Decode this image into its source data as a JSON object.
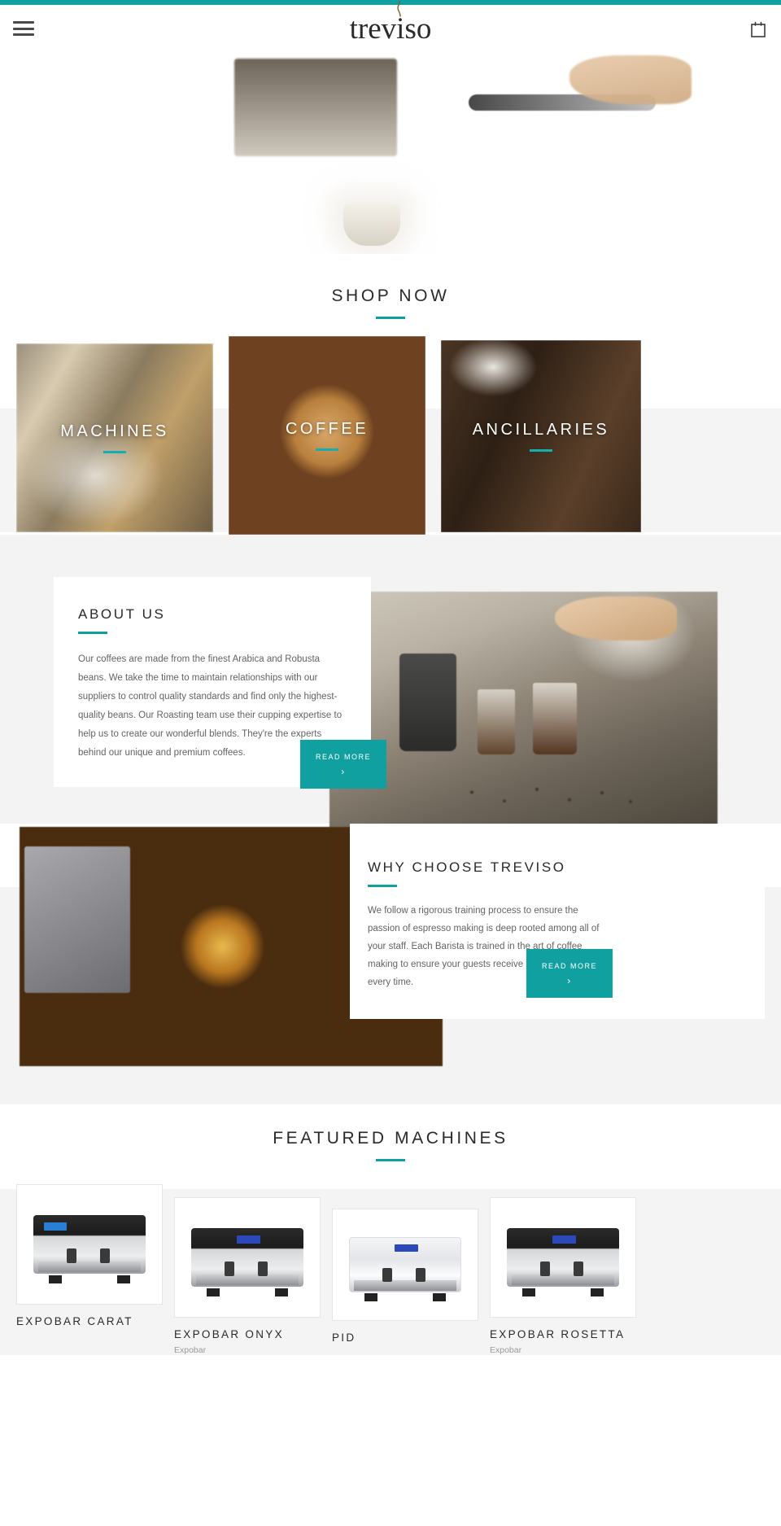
{
  "theme": {
    "accent": "#11a0a0",
    "tile_accent": "#15b0ae",
    "text_dark": "#2a2a2a",
    "text_body": "#636363",
    "band_grey": "#f4f4f4"
  },
  "header": {
    "menu_icon": "hamburger-menu-icon",
    "logo_text": "treviso",
    "cart_icon": "shopping-bag-icon"
  },
  "hero": {
    "alt": "espresso machine pouring coffee into white cup with steam"
  },
  "shop": {
    "heading": "SHOP NOW",
    "tiles": [
      {
        "label": "MACHINES"
      },
      {
        "label": "COFFEE"
      },
      {
        "label": "ANCILLARIES"
      }
    ]
  },
  "about": {
    "heading": "ABOUT US",
    "body": "Our coffees are made from the finest Arabica and Robusta beans. We take the time to maintain relationships with our suppliers to control quality standards and find only the highest-quality beans. Our Roasting team use their cupping expertise to help us to create our wonderful blends. They're the experts behind our unique and premium coffees.",
    "button_label": "READ MORE",
    "button_chevron": "›"
  },
  "why": {
    "heading": "WHY CHOOSE TREVISO",
    "body": "We follow a rigorous training process to ensure the passion of espresso making is deep rooted among all of your staff. Each Barista is trained in the art of coffee making to ensure your guests receive the perfect coffee every time.",
    "button_label": "READ MORE",
    "button_chevron": "›"
  },
  "featured": {
    "heading": "FEATURED MACHINES",
    "products": [
      {
        "title": "EXPOBAR CARAT",
        "vendor": ""
      },
      {
        "title": "EXPOBAR ONYX",
        "vendor": "Expobar"
      },
      {
        "title": "PID",
        "vendor": ""
      },
      {
        "title": "EXPOBAR ROSETTA",
        "vendor": "Expobar"
      }
    ]
  }
}
